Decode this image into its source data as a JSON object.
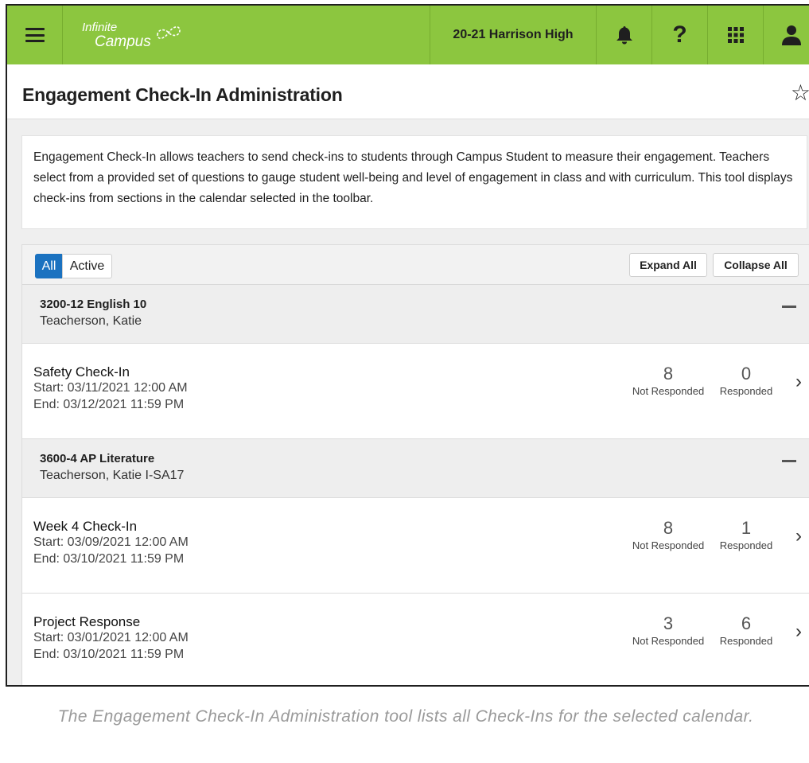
{
  "header": {
    "logo_line1": "Infinite",
    "logo_line2": "Campus",
    "school": "20-21 Harrison High"
  },
  "page": {
    "title": "Engagement Check-In Administration"
  },
  "description": "Engagement Check-In allows teachers to send check-ins to students through Campus Student to measure their engagement. Teachers select from a provided set of questions to gauge student well-being and level of engagement in class and with curriculum. This tool displays check-ins from sections in the calendar selected in the toolbar.",
  "filters": {
    "all": "All",
    "active": "Active",
    "expand_all": "Expand All",
    "collapse_all": "Collapse All"
  },
  "sections": [
    {
      "name": "3200-12 English 10",
      "teacher": "Teacherson, Katie",
      "checkins": [
        {
          "name": "Safety Check-In",
          "start": "Start: 03/11/2021 12:00 AM",
          "end": "End: 03/12/2021 11:59 PM",
          "not_responded": "8",
          "responded": "0"
        }
      ]
    },
    {
      "name": "3600-4 AP Literature",
      "teacher": "Teacherson, Katie I-SA17",
      "checkins": [
        {
          "name": "Week 4 Check-In",
          "start": "Start: 03/09/2021 12:00 AM",
          "end": "End: 03/10/2021 11:59 PM",
          "not_responded": "8",
          "responded": "1"
        },
        {
          "name": "Project Response",
          "start": "Start: 03/01/2021 12:00 AM",
          "end": "End: 03/10/2021 11:59 PM",
          "not_responded": "3",
          "responded": "6"
        }
      ]
    }
  ],
  "labels": {
    "not_responded": "Not Responded",
    "responded": "Responded"
  },
  "caption": "The Engagement Check-In Administration tool lists all Check-Ins for the selected calendar.",
  "colors": {
    "brand_green": "#8cc63f",
    "accent_blue": "#1b72c0"
  },
  "icons": [
    "menu-icon",
    "bell-icon",
    "help-icon",
    "apps-grid-icon",
    "user-icon",
    "star-icon",
    "collapse-icon",
    "chevron-right-icon"
  ]
}
